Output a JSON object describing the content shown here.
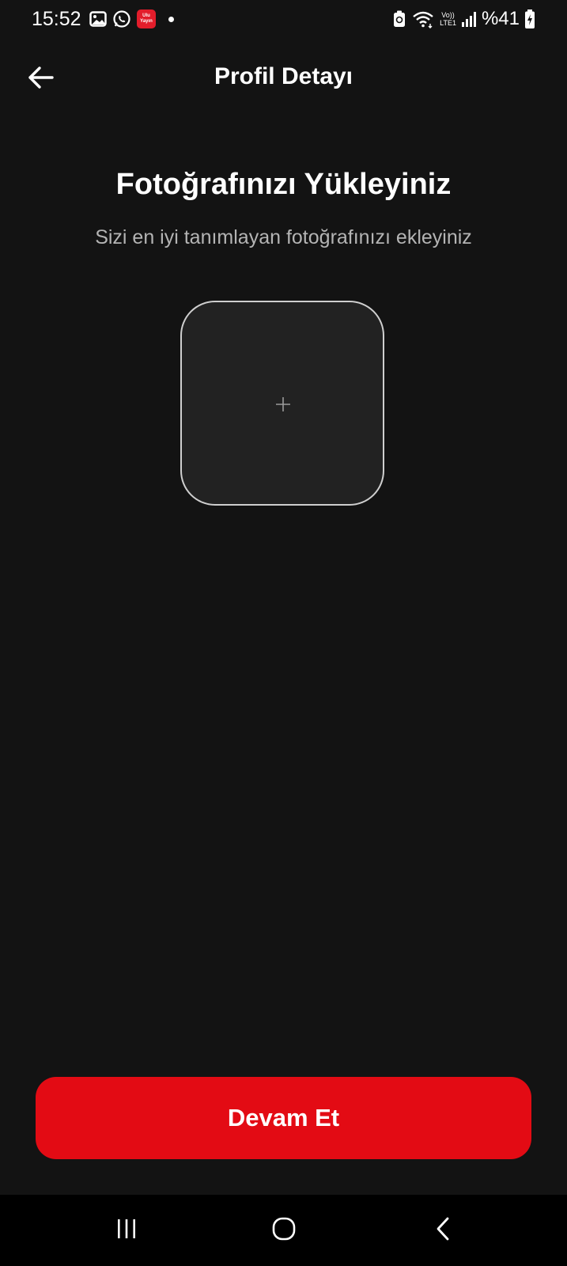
{
  "status_bar": {
    "time": "15:52",
    "app_badge_text": "Ulu Yayın",
    "network_label_top": "Vo))",
    "network_label_bottom": "LTE1",
    "battery_percent": "%41",
    "icons": [
      "gallery-icon",
      "whatsapp-icon",
      "app-badge-icon",
      "notification-dot",
      "battery-saver-icon",
      "wifi-icon",
      "volte-icon",
      "signal-icon",
      "battery-icon"
    ]
  },
  "header": {
    "title": "Profil Detayı",
    "back_icon": "arrow-left-icon"
  },
  "main": {
    "heading": "Fotoğrafınızı Yükleyiniz",
    "subheading": "Sizi en iyi tanımlayan fotoğrafınızı ekleyiniz",
    "upload_icon": "plus-icon"
  },
  "footer": {
    "continue_label": "Devam Et"
  },
  "nav_bar": {
    "icons": [
      "recent-apps-icon",
      "home-icon",
      "back-icon"
    ]
  },
  "colors": {
    "background": "#131313",
    "accent": "#e30b14",
    "upload_box": "#222222",
    "upload_border": "#cfcfcf",
    "subtext": "#b4b4b4",
    "nav_background": "#000000"
  }
}
